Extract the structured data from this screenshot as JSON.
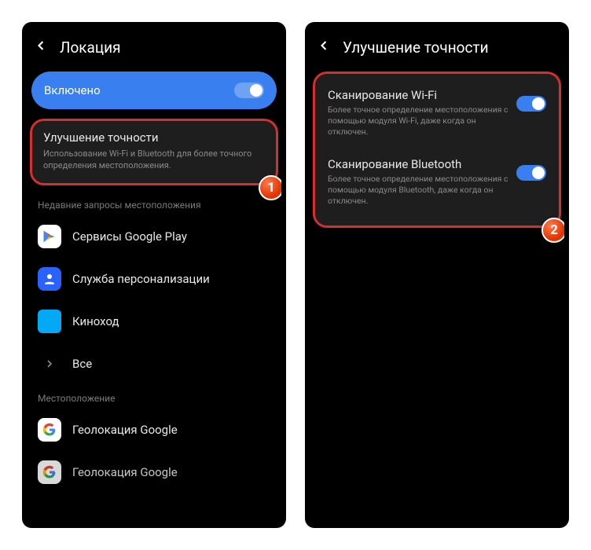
{
  "screen1": {
    "header_title": "Локация",
    "enabled_pill": "Включено",
    "accuracy": {
      "title": "Улучшение точности",
      "desc": "Использование Wi-Fi и Bluetooth для более точного определения местоположения."
    },
    "section_recent": "Недавние запросы местоположения",
    "items": {
      "google_play": "Сервисы Google Play",
      "persona": "Служба персонализации",
      "kino": "Киноход",
      "all": "Все"
    },
    "section_loc": "Местоположение",
    "geo1": "Геолокация Google",
    "geo2": "Геолокация Google",
    "badge": "1"
  },
  "screen2": {
    "header_title": "Улучшение точности",
    "wifi": {
      "title": "Сканирование Wi-Fi",
      "desc": "Более точное определение местоположения с помощью модуля Wi-Fi, даже когда он отключен."
    },
    "bt": {
      "title": "Сканирование Bluetooth",
      "desc": "Более точное определение местоположения с помощью модуля Bluetooth, даже когда он отключен."
    },
    "badge": "2"
  }
}
